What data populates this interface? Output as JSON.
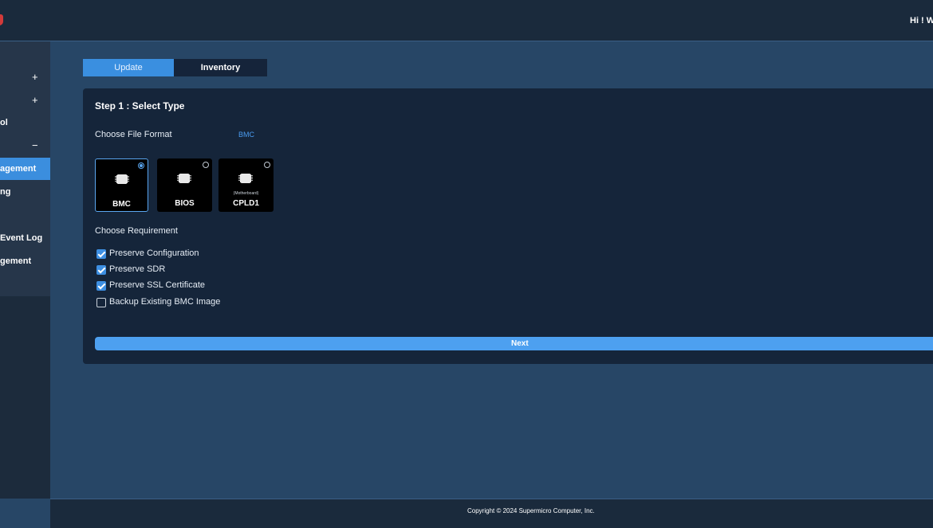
{
  "header": {
    "greeting": "Hi ! W"
  },
  "sidebar": {
    "items": [
      {
        "label": "",
        "sign": "+"
      },
      {
        "label": "",
        "sign": "+"
      },
      {
        "label": "ol",
        "sign": ""
      },
      {
        "label": "",
        "sign": "−"
      },
      {
        "label": "agement",
        "sign": "",
        "active": true
      },
      {
        "label": "ng",
        "sign": ""
      },
      {
        "label": "",
        "sign": ""
      },
      {
        "label": "Event Log",
        "sign": ""
      },
      {
        "label": "gement",
        "sign": ""
      }
    ]
  },
  "tabs": [
    {
      "label": "Update",
      "active": true
    },
    {
      "label": "Inventory",
      "active": false
    }
  ],
  "step": {
    "title": "Step 1 : Select Type",
    "file_format_label": "Choose File Format",
    "file_format_value": "BMC",
    "cards": [
      {
        "label": "BMC",
        "sub": "",
        "selected": true,
        "icon": "chip-icon"
      },
      {
        "label": "BIOS",
        "sub": "",
        "selected": false,
        "icon": "chip-icon"
      },
      {
        "label": "CPLD1",
        "sub": "(Motherboard)",
        "selected": false,
        "icon": "chip-icon"
      }
    ],
    "requirement_label": "Choose Requirement",
    "requirements": [
      {
        "label": "Preserve Configuration",
        "checked": true
      },
      {
        "label": "Preserve SDR",
        "checked": true
      },
      {
        "label": "Preserve SSL Certificate",
        "checked": true
      },
      {
        "label": "Backup Existing BMC Image",
        "checked": false
      }
    ],
    "next_label": "Next"
  },
  "footer": {
    "copyright": "Copyright © 2024 Supermicro Computer, Inc."
  },
  "colors": {
    "accent": "#3a8fe0",
    "background": "#274666",
    "panel": "#15253a",
    "header": "#1a2a3c"
  }
}
